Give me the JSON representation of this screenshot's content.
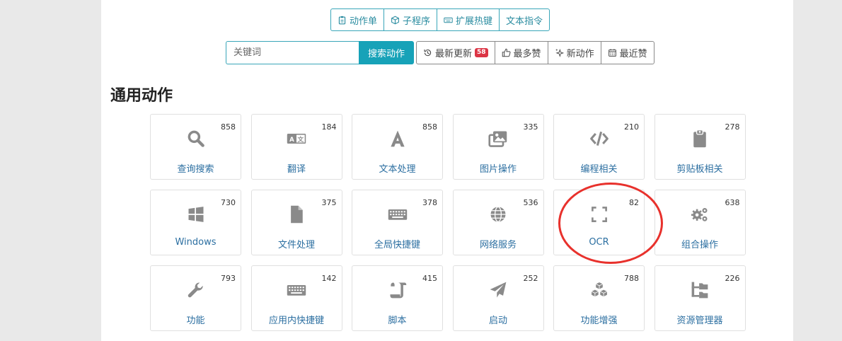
{
  "tabs": [
    {
      "label": "动作单",
      "icon": "clipboard-icon"
    },
    {
      "label": "子程序",
      "icon": "cube-icon"
    },
    {
      "label": "扩展热键",
      "icon": "keyboard-icon"
    },
    {
      "label": "文本指令",
      "icon": ""
    }
  ],
  "search": {
    "placeholder": "关键词",
    "button_label": "搜索动作"
  },
  "filters": [
    {
      "label": "最新更新",
      "icon": "history-icon",
      "badge": "58"
    },
    {
      "label": "最多赞",
      "icon": "thumbs-up-icon"
    },
    {
      "label": "新动作",
      "icon": "sparkle-icon"
    },
    {
      "label": "最近赞",
      "icon": "calendar-icon"
    }
  ],
  "section_title": "通用动作",
  "cards": [
    {
      "label": "查询搜索",
      "count": "858",
      "icon": "search-icon"
    },
    {
      "label": "翻译",
      "count": "184",
      "icon": "translate-icon"
    },
    {
      "label": "文本处理",
      "count": "858",
      "icon": "font-icon"
    },
    {
      "label": "图片操作",
      "count": "335",
      "icon": "images-icon"
    },
    {
      "label": "编程相关",
      "count": "210",
      "icon": "code-icon"
    },
    {
      "label": "剪贴板相关",
      "count": "278",
      "icon": "clipboard-icon"
    },
    {
      "label": "Windows",
      "count": "730",
      "icon": "windows-icon"
    },
    {
      "label": "文件处理",
      "count": "375",
      "icon": "file-icon"
    },
    {
      "label": "全局快捷键",
      "count": "378",
      "icon": "keyboard-icon"
    },
    {
      "label": "网络服务",
      "count": "536",
      "icon": "globe-icon"
    },
    {
      "label": "OCR",
      "count": "82",
      "icon": "scan-frame-icon"
    },
    {
      "label": "组合操作",
      "count": "638",
      "icon": "gears-icon"
    },
    {
      "label": "功能",
      "count": "793",
      "icon": "wrench-icon"
    },
    {
      "label": "应用内快捷键",
      "count": "142",
      "icon": "keyboard-icon"
    },
    {
      "label": "脚本",
      "count": "415",
      "icon": "scroll-icon"
    },
    {
      "label": "启动",
      "count": "252",
      "icon": "paper-plane-icon"
    },
    {
      "label": "功能增强",
      "count": "788",
      "icon": "cubes-icon"
    },
    {
      "label": "资源管理器",
      "count": "226",
      "icon": "folder-tree-icon"
    }
  ],
  "colors": {
    "accent": "#17a2b8",
    "link": "#2c6fa1",
    "badge": "#dc3545",
    "highlight_circle": "#e8312c",
    "icon_gray": "#8a8a8a"
  }
}
